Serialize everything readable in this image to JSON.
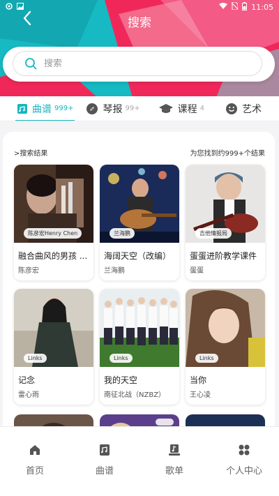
{
  "status_bar": {
    "time": "11:05"
  },
  "header": {
    "title": "搜索"
  },
  "search": {
    "placeholder": "搜索"
  },
  "tabs": [
    {
      "label": "曲谱",
      "count": "999+",
      "icon": "score-icon",
      "active": true
    },
    {
      "label": "琴报",
      "count": "99+",
      "icon": "compass-icon",
      "active": false
    },
    {
      "label": "课程",
      "count": "4",
      "icon": "graduation-cap-icon",
      "active": false
    },
    {
      "label": "艺术",
      "count": "",
      "icon": "smiley-icon",
      "active": false
    }
  ],
  "results": {
    "heading": ">搜索结果",
    "summary": "为您找到约999+个结果",
    "items": [
      {
        "badge": "陈彦宏Henry Chen",
        "title": "融合曲风的男孩 ...",
        "artist": "陈彦宏"
      },
      {
        "badge": "兰海鹏",
        "title": "海阔天空（改编）",
        "artist": "兰海鹏"
      },
      {
        "badge": "吉他情报局",
        "title": "蛋蛋进阶教学课件",
        "artist": "蛋蛋"
      },
      {
        "badge": "Links",
        "title": "记念",
        "artist": "雷心雨"
      },
      {
        "badge": "Links",
        "title": "我的天空",
        "artist": "南征北战（NZBZ）"
      },
      {
        "badge": "Links",
        "title": "当你",
        "artist": "王心凌"
      }
    ]
  },
  "bottom_nav": [
    {
      "label": "首页",
      "icon": "home-icon"
    },
    {
      "label": "曲谱",
      "icon": "score-icon"
    },
    {
      "label": "歌单",
      "icon": "playlist-icon"
    },
    {
      "label": "个人中心",
      "icon": "profile-icon"
    }
  ],
  "colors": {
    "accent": "#16b6be",
    "header_teal": "#17b9c2",
    "header_pink": "#f0285a"
  }
}
